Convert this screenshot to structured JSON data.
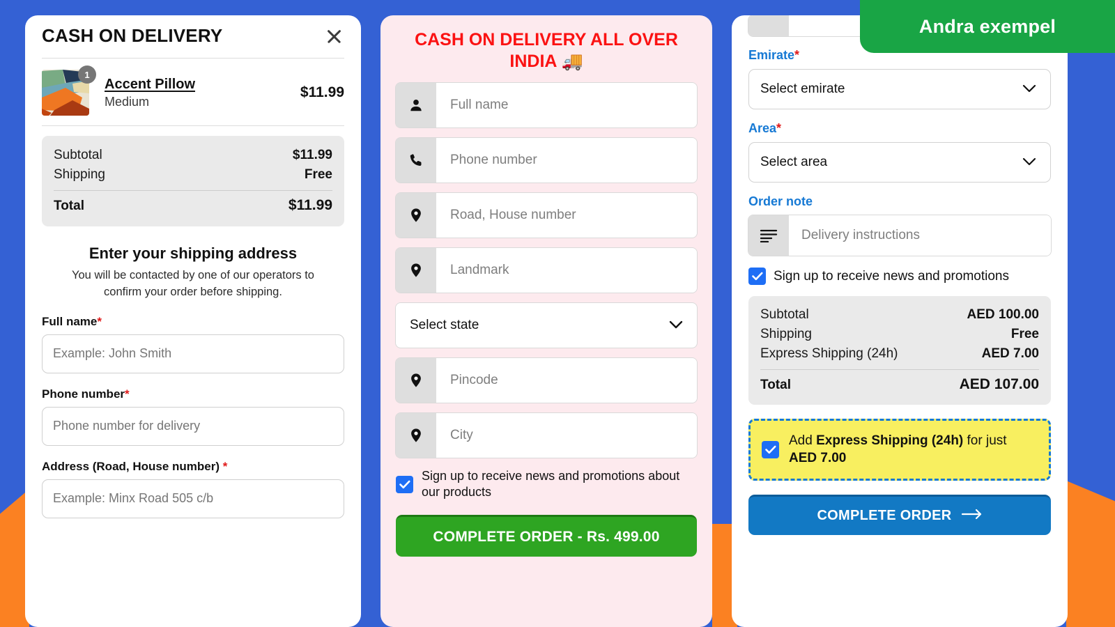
{
  "banner": {
    "label": "Andra exempel"
  },
  "card1": {
    "title": "CASH ON DELIVERY",
    "close_icon": "close-icon",
    "line_item": {
      "qty": "1",
      "name": "Accent Pillow",
      "variant": "Medium",
      "price": "$11.99"
    },
    "summary": {
      "rows": [
        {
          "label": "Subtotal",
          "value": "$11.99"
        },
        {
          "label": "Shipping",
          "value": "Free"
        }
      ],
      "total_label": "Total",
      "total_value": "$11.99"
    },
    "address_title": "Enter your shipping address",
    "address_sub": "You will be contacted by one of our operators to confirm your order before shipping.",
    "fields": [
      {
        "label": "Full name",
        "required": "*",
        "placeholder": "Example: John Smith"
      },
      {
        "label": "Phone number",
        "required": "*",
        "placeholder": "Phone number for delivery"
      },
      {
        "label": "Address (Road, House number)",
        "required": "*",
        "placeholder": "Example: Minx Road 505 c/b"
      }
    ]
  },
  "card2": {
    "title": "CASH ON DELIVERY ALL OVER INDIA 🚚",
    "fields": [
      {
        "icon": "person-icon",
        "placeholder": "Full name"
      },
      {
        "icon": "phone-icon",
        "placeholder": "Phone number"
      },
      {
        "icon": "map-pin-icon",
        "placeholder": "Road, House number"
      },
      {
        "icon": "map-pin-icon",
        "placeholder": "Landmark"
      }
    ],
    "state_select": "Select state",
    "fields2": [
      {
        "icon": "map-pin-icon",
        "placeholder": "Pincode"
      },
      {
        "icon": "map-pin-icon",
        "placeholder": "City"
      }
    ],
    "newsletter": {
      "checked": true,
      "label": "Sign up to receive news and promotions about our products"
    },
    "submit_label": "COMPLETE ORDER - Rs. 499.00"
  },
  "card3": {
    "emirate_label": "Emirate",
    "emirate_required": "*",
    "emirate_value": "Select emirate",
    "area_label": "Area",
    "area_required": "*",
    "area_value": "Select area",
    "note_label": "Order note",
    "note_placeholder": "Delivery instructions",
    "newsletter": {
      "checked": true,
      "label": "Sign up to receive news and promotions"
    },
    "summary": {
      "rows": [
        {
          "label": "Subtotal",
          "value": "AED 100.00"
        },
        {
          "label": "Shipping",
          "value": "Free"
        },
        {
          "label": "Express Shipping (24h)",
          "value": "AED 7.00"
        }
      ],
      "total_label": "Total",
      "total_value": "AED 107.00"
    },
    "upsell": {
      "checked": true,
      "prefix": "Add ",
      "bold1": "Express Shipping (24h)",
      "middle": " for just ",
      "bold2": "AED 7.00"
    },
    "submit_label": "COMPLETE ORDER"
  },
  "colors": {
    "background_blue": "#3461d4",
    "accent_orange": "#fb8122",
    "banner_green": "#19a545",
    "card2_pink": "#fdeaee",
    "card2_red_text": "#fb1212",
    "card3_blue_label": "#1679d4",
    "checkbox_blue": "#1e6ef5",
    "upsell_yellow": "#f8ef60",
    "green_button": "#2ea522",
    "blue_button": "#1279c4",
    "required_red": "#e01919"
  }
}
